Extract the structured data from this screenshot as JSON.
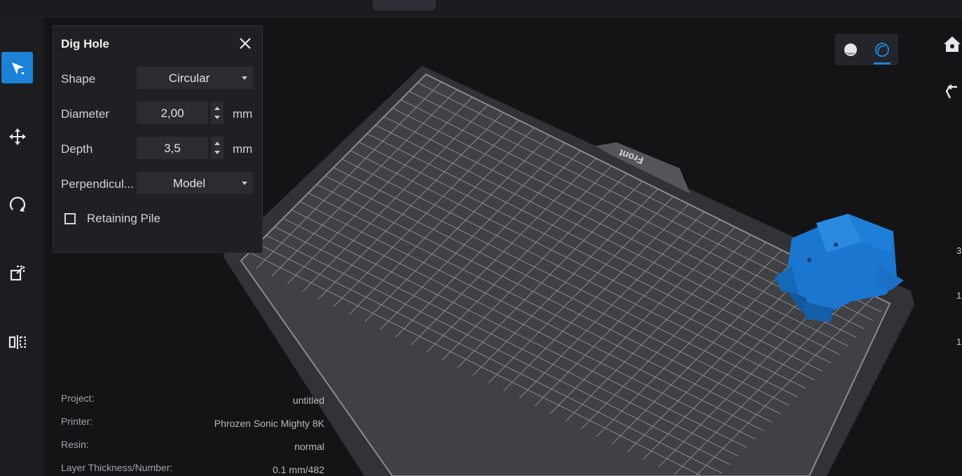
{
  "panel": {
    "title": "Dig Hole",
    "shape_label": "Shape",
    "shape_value": "Circular",
    "diameter_label": "Diameter",
    "diameter_value": "2,00",
    "diameter_unit": "mm",
    "depth_label": "Depth",
    "depth_value": "3,5",
    "depth_unit": "mm",
    "perpendicular_label": "Perpendicul...",
    "perpendicular_value": "Model",
    "retaining_label": "Retaining Pile",
    "retaining_checked": false
  },
  "viewport": {
    "plate_label": "Front",
    "model_color": "#1c78d2",
    "accent": "#1c82d8"
  },
  "info": {
    "project_label": "Project:",
    "project_value": "untitled",
    "printer_label": "Printer:",
    "printer_value": "Phrozen Sonic Mighty 8K",
    "resin_label": "Resin:",
    "resin_value": "normal",
    "layer_label": "Layer Thickness/Number:",
    "layer_value": "0.1 mm/482"
  },
  "toolbar": {
    "tools": [
      "select-icon",
      "move-icon",
      "rotate-icon",
      "scale-icon",
      "mirror-icon"
    ]
  },
  "right_edge": [
    "3,",
    "1,",
    "1,"
  ]
}
